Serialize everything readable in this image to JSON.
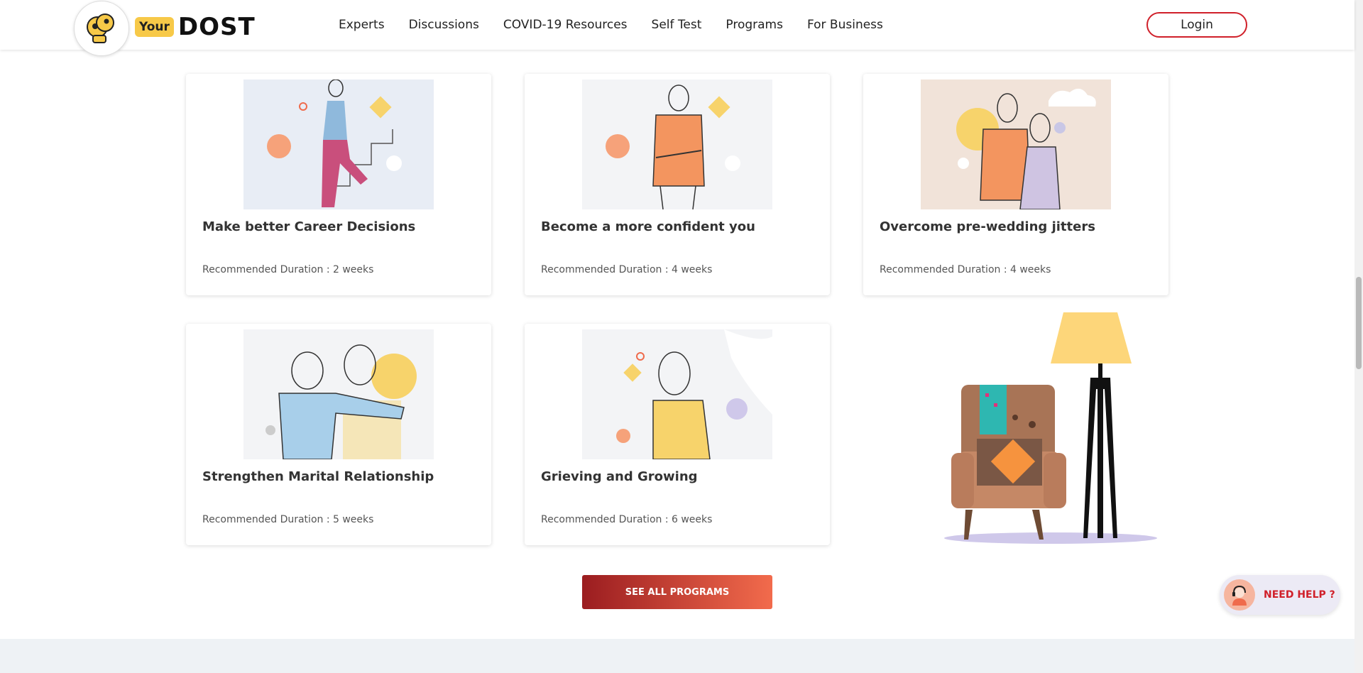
{
  "header": {
    "logo_your": "Your",
    "logo_dost": "DOST",
    "nav": [
      "Experts",
      "Discussions",
      "COVID-19 Resources",
      "Self Test",
      "Programs",
      "For Business"
    ],
    "login_label": "Login"
  },
  "programs": [
    {
      "title": "Make better Career Decisions",
      "duration": "Recommended Duration : 2 weeks"
    },
    {
      "title": "Become a more confident you",
      "duration": "Recommended Duration : 4 weeks"
    },
    {
      "title": "Overcome pre-wedding jitters",
      "duration": "Recommended Duration : 4 weeks"
    },
    {
      "title": "Strengthen Marital Relationship",
      "duration": "Recommended Duration : 5 weeks"
    },
    {
      "title": "Grieving and Growing",
      "duration": "Recommended Duration : 6 weeks"
    }
  ],
  "see_all_label": "SEE ALL PROGRAMS",
  "need_help_label": "NEED HELP ?",
  "colors": {
    "brand_red": "#d0202a",
    "brand_yellow": "#f7c948",
    "accent_orange": "#f26b4c"
  }
}
